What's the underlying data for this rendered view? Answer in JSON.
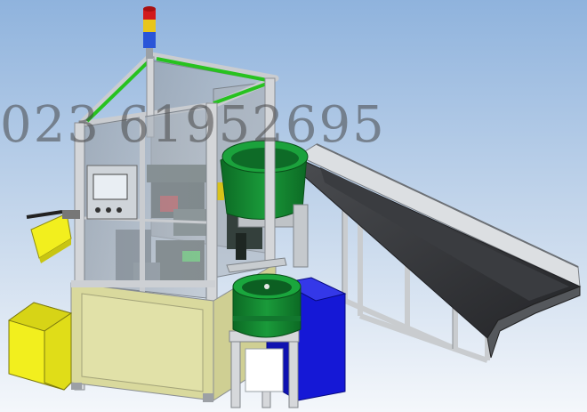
{
  "watermark": {
    "text": "023 61952695"
  },
  "colors": {
    "background_top": "#8fb3dd",
    "background_bottom": "#f4f7fb",
    "frame": "#c7c9cc",
    "glass": "#9aa3ad",
    "accent_green": "#27c21f",
    "bowl_green": "#0f7a2c",
    "bin_yellow": "#f2ef1e",
    "blue_box": "#1518d6",
    "chute_dark": "#2f3033",
    "cabinet": "#d8d89a",
    "beacon_red": "#d21a1a",
    "beacon_yellow": "#e8c51b",
    "beacon_blue": "#2a55d8"
  },
  "components": {
    "signal_tower": "signal-tower",
    "hmi_panel": "hmi-panel",
    "large_vibratory_bowl": "large-feeder-bowl",
    "small_vibratory_bowl": "small-feeder-bowl",
    "conveyor_chute": "long-chute",
    "collection_bin": "yellow-bin",
    "side_tray": "yellow-tray",
    "blue_enclosure": "blue-cabinet"
  }
}
